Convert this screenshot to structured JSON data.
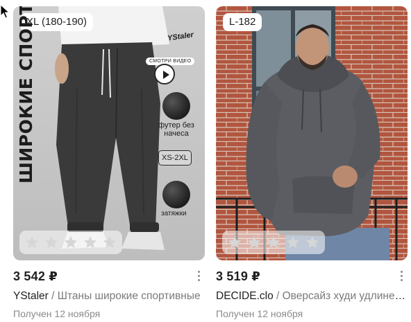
{
  "products": [
    {
      "size_badge": "XL (180-190)",
      "price": "3 542 ₽",
      "brand": "YStaler",
      "separator": "/",
      "name": "Штаны широкие спортивные",
      "received": "Получен 12 ноября",
      "rating_stars": 5,
      "ad_text": {
        "headline": "ШИРОКИЕ СПОРТИВКИ",
        "logo": "YStaler",
        "video_label": "СМОТРИ ВИДЕО",
        "fabric_label": "футер без начеса",
        "size_range": "XS-2XL",
        "ties_label": "затяжки"
      }
    },
    {
      "size_badge": "L-182",
      "price": "3 519 ₽",
      "brand": "DECIDE.clo",
      "separator": "/",
      "name": "Оверсайз худи удлиненное",
      "received": "Получен 12 ноября",
      "rating_stars": 5
    }
  ],
  "colors": {
    "star_empty": "#d0d0d0",
    "text_primary": "#1f1f1f",
    "text_secondary": "#7a7a7a"
  }
}
